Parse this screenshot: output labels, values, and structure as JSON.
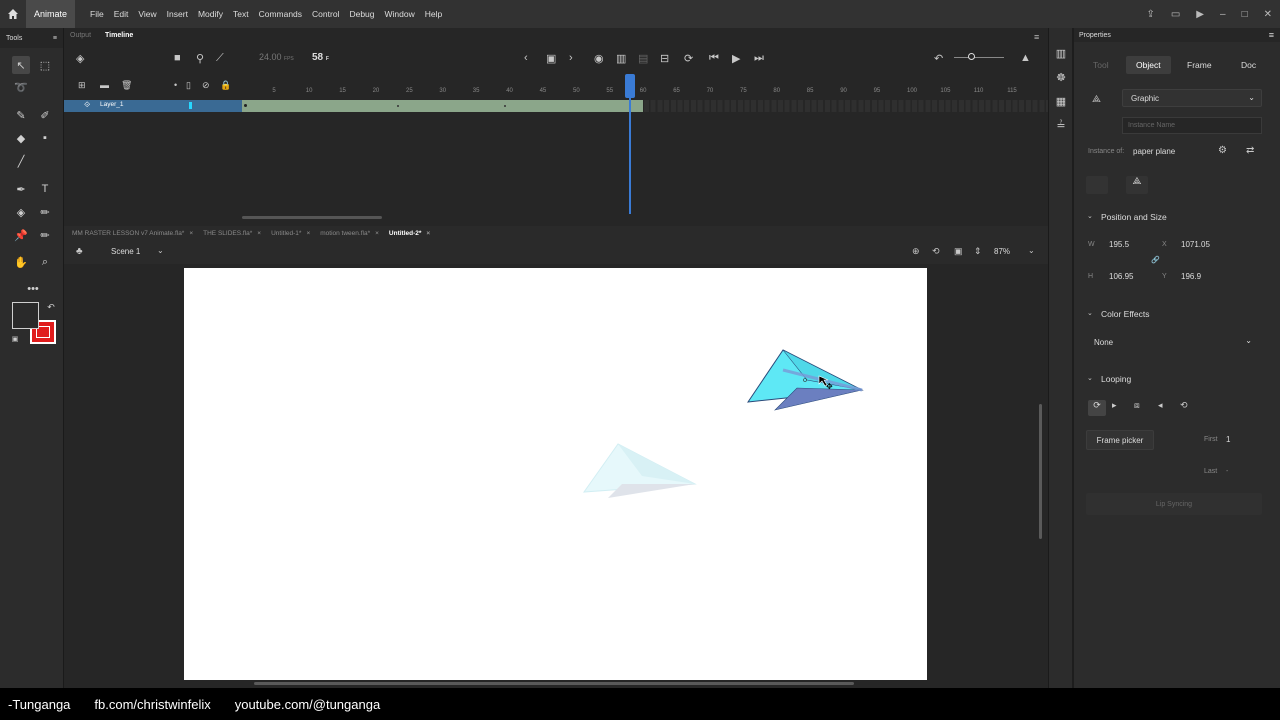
{
  "menubar": {
    "app_name": "Animate",
    "items": [
      "File",
      "Edit",
      "View",
      "Insert",
      "Modify",
      "Text",
      "Commands",
      "Control",
      "Debug",
      "Window",
      "Help"
    ]
  },
  "tools_panel": {
    "title": "Tools"
  },
  "timeline_tabs": {
    "output": "Output",
    "timeline": "Timeline"
  },
  "timeline": {
    "fps": "24.00",
    "fps_unit": "FPS",
    "current_frame": "58",
    "frame_suffix": "F",
    "layer_name": "Layer_1",
    "ruler_ticks": [
      "5",
      "10",
      "15",
      "20",
      "25",
      "30",
      "35",
      "40",
      "45",
      "50",
      "55",
      "60",
      "65",
      "70",
      "75",
      "80",
      "85",
      "90",
      "95",
      "100",
      "105",
      "110",
      "115"
    ],
    "tween_end_frame": 60
  },
  "doc_tabs": [
    {
      "label": "MM RASTER LESSON v7 Animate.fla*",
      "active": false
    },
    {
      "label": "THE SLIDES.fla*",
      "active": false
    },
    {
      "label": "Untitled-1*",
      "active": false
    },
    {
      "label": "motion tween.fla*",
      "active": false
    },
    {
      "label": "Untitled-2*",
      "active": true
    }
  ],
  "scene": {
    "label": "Scene 1",
    "zoom": "87%"
  },
  "properties": {
    "title": "Properties",
    "tabs": [
      "Tool",
      "Object",
      "Frame",
      "Doc"
    ],
    "active_tab": "Object",
    "symbol_type": "Graphic",
    "instance_name_placeholder": "Instance Name",
    "instance_of_label": "Instance of:",
    "instance_of_value": "paper plane",
    "position_size": {
      "title": "Position and Size",
      "w_label": "W",
      "w": "195.5",
      "x_label": "X",
      "x": "1071.05",
      "h_label": "H",
      "h": "106.95",
      "y_label": "Y",
      "y": "196.9"
    },
    "color_effects": {
      "title": "Color Effects",
      "value": "None"
    },
    "looping": {
      "title": "Looping",
      "frame_picker": "Frame picker",
      "first_label": "First",
      "first_value": "1",
      "last_label": "Last",
      "last_value": "-",
      "lip_sync": "Lip Syncing"
    }
  },
  "footer": {
    "items": [
      "-Tunganga",
      "fb.com/christwinfelix",
      "youtube.com/@tunganga"
    ]
  },
  "colors": {
    "plane": "#5ee8f5",
    "plane_ghost": "#e4f7fa",
    "fill_swatch": "#e01c1c",
    "playhead": "#3a7bd5",
    "tween": "#8ba68a",
    "layer_selected": "#3a6a94"
  }
}
